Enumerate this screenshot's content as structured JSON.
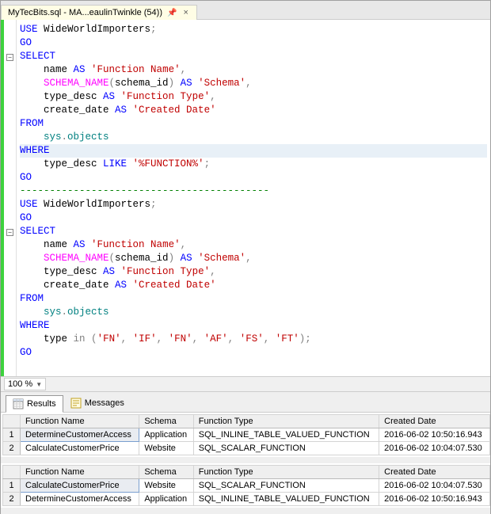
{
  "tab": {
    "title": "MyTecBits.sql - MA...eaulinTwinkle (54))"
  },
  "code": {
    "l01a": "USE",
    "l01b": " WideWorldImporters",
    "l01c": ";",
    "l02": "GO",
    "l03": "SELECT",
    "l04a": "name ",
    "l04b": "AS",
    "l04c": " 'Function Name'",
    "l04d": ",",
    "l05a": "SCHEMA_NAME",
    "l05b": "(",
    "l05c": "schema_id",
    "l05d": ")",
    "l05e": " AS",
    "l05f": " 'Schema'",
    "l05g": ",",
    "l06a": "type_desc ",
    "l06b": "AS",
    "l06c": " 'Function Type'",
    "l06d": ",",
    "l07a": "create_date ",
    "l07b": "AS",
    "l07c": " 'Created Date'",
    "l08": "FROM",
    "l09a": "sys",
    "l09b": ".",
    "l09c": "objects",
    "l10": "WHERE ",
    "l11a": "type_desc ",
    "l11b": "LIKE",
    "l11c": " '%FUNCTION%'",
    "l11d": ";",
    "l12": "GO",
    "l13": "------------------------------------------",
    "l19a": "type ",
    "l19b": "in",
    "l19c": " (",
    "l19d": "'FN'",
    "l19e": ", ",
    "l19f": "'IF'",
    "l19g": ", ",
    "l19h": "'FN'",
    "l19i": ", ",
    "l19j": "'AF'",
    "l19k": ", ",
    "l19l": "'FS'",
    "l19m": ", ",
    "l19n": "'FT'",
    "l19o": ");"
  },
  "zoom": {
    "value": "100 %"
  },
  "resultsTabs": {
    "results": "Results",
    "messages": "Messages"
  },
  "columns": {
    "c1": "Function Name",
    "c2": "Schema",
    "c3": "Function Type",
    "c4": "Created Date"
  },
  "grid1": {
    "r1": {
      "n": "1",
      "c1": "DetermineCustomerAccess",
      "c2": "Application",
      "c3": "SQL_INLINE_TABLE_VALUED_FUNCTION",
      "c4": "2016-06-02 10:50:16.943"
    },
    "r2": {
      "n": "2",
      "c1": "CalculateCustomerPrice",
      "c2": "Website",
      "c3": "SQL_SCALAR_FUNCTION",
      "c4": "2016-06-02 10:04:07.530"
    }
  },
  "grid2": {
    "r1": {
      "n": "1",
      "c1": "CalculateCustomerPrice",
      "c2": "Website",
      "c3": "SQL_SCALAR_FUNCTION",
      "c4": "2016-06-02 10:04:07.530"
    },
    "r2": {
      "n": "2",
      "c1": "DetermineCustomerAccess",
      "c2": "Application",
      "c3": "SQL_INLINE_TABLE_VALUED_FUNCTION",
      "c4": "2016-06-02 10:50:16.943"
    }
  }
}
